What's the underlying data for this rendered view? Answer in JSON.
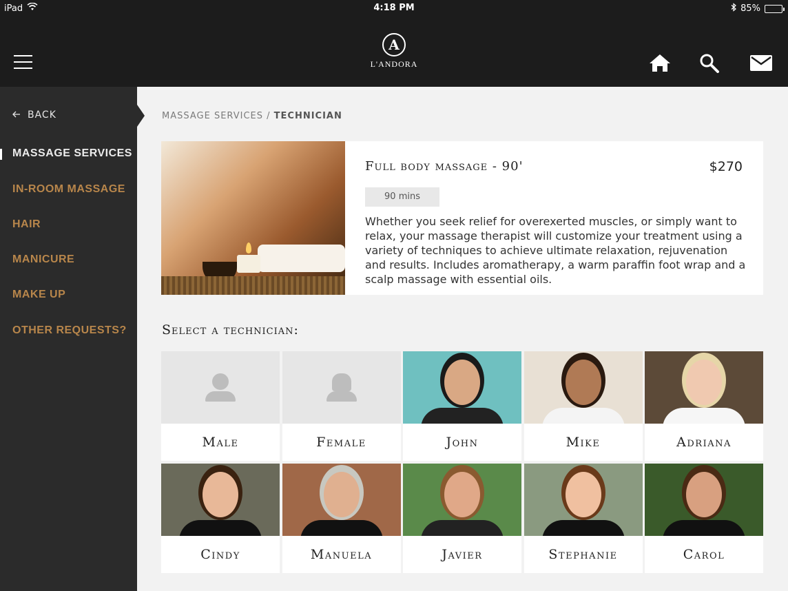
{
  "status_bar": {
    "device": "iPad",
    "time": "4:18 PM",
    "battery": "85%",
    "battery_level": 0.85
  },
  "header": {
    "logo_letter": "A",
    "logo_name": "L'ANDORA",
    "icons": [
      "menu-icon",
      "home-icon",
      "search-icon",
      "mail-icon"
    ]
  },
  "sidebar": {
    "back_label": "BACK",
    "items": [
      {
        "label": "MASSAGE SERVICES",
        "active": true
      },
      {
        "label": "IN-ROOM MASSAGE",
        "active": false
      },
      {
        "label": "HAIR",
        "active": false
      },
      {
        "label": "MANICURE",
        "active": false
      },
      {
        "label": "MAKE UP",
        "active": false
      },
      {
        "label": "OTHER REQUESTS?",
        "active": false
      }
    ]
  },
  "breadcrumb": {
    "parent": "MASSAGE SERVICES",
    "separator": " / ",
    "current": "TECHNICIAN"
  },
  "service": {
    "title": "Full body massage - 90'",
    "price": "$270",
    "duration": "90 mins",
    "description": "Whether you seek relief for overexerted muscles, or simply want to relax, your massage therapist will customize your treatment using a variety of techniques to achieve ultimate relaxation, rejuvenation and results. Includes aromatherapy, a warm paraffin foot wrap and a scalp massage with essential oils."
  },
  "technician_section": {
    "title": "Select a technician:",
    "technicians": [
      {
        "name": "Male",
        "type": "placeholder"
      },
      {
        "name": "Female",
        "type": "placeholder"
      },
      {
        "name": "John",
        "type": "photo"
      },
      {
        "name": "Mike",
        "type": "photo"
      },
      {
        "name": "Adriana",
        "type": "photo"
      },
      {
        "name": "Cindy",
        "type": "photo"
      },
      {
        "name": "Manuela",
        "type": "photo"
      },
      {
        "name": "Javier",
        "type": "photo"
      },
      {
        "name": "Stephanie",
        "type": "photo"
      },
      {
        "name": "Carol",
        "type": "photo"
      }
    ]
  },
  "colors": {
    "header_bg": "#1c1c1c",
    "sidebar_bg": "#2b2b2b",
    "accent_gold": "#b8864b",
    "page_bg": "#f2f2f2"
  }
}
